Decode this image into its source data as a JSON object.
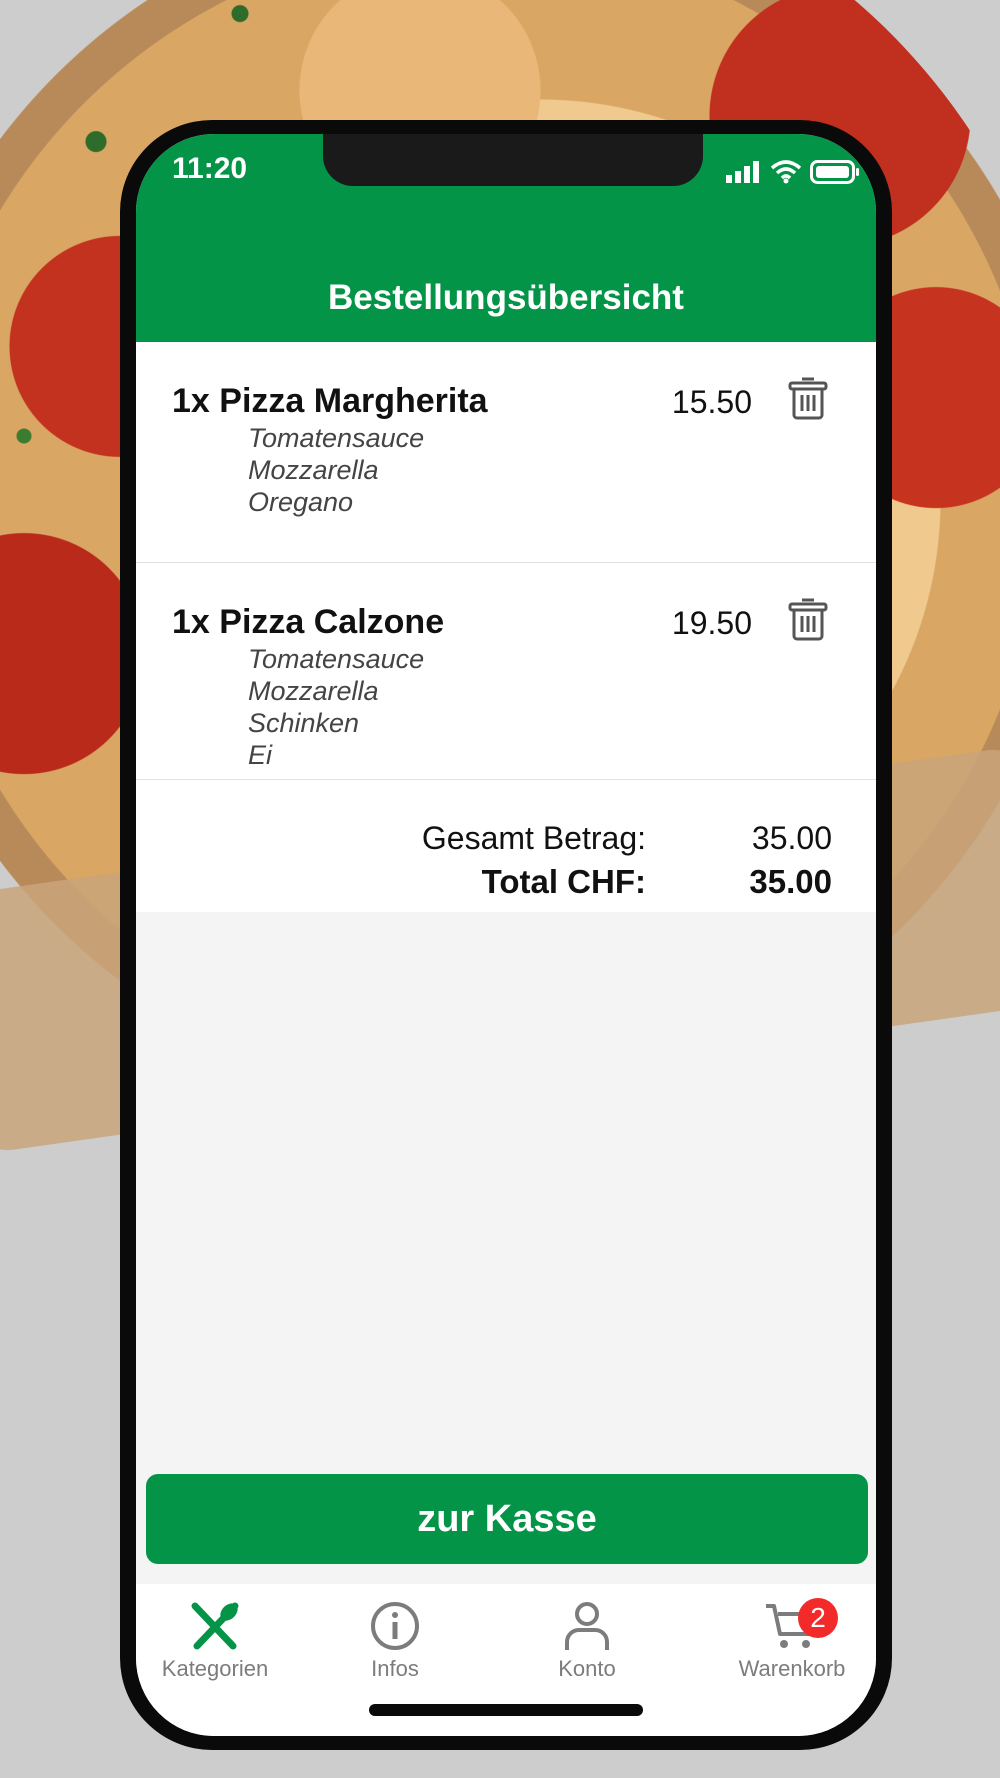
{
  "status_bar": {
    "time": "11:20"
  },
  "header": {
    "title": "Bestellungsübersicht"
  },
  "order_items": [
    {
      "name": "1x Pizza Margherita",
      "price": "15.50",
      "toppings": [
        "Tomatensauce",
        "Mozzarella",
        "Oregano"
      ]
    },
    {
      "name": "1x Pizza Calzone",
      "price": "19.50",
      "toppings": [
        "Tomatensauce",
        "Mozzarella",
        "Schinken",
        "Ei"
      ]
    }
  ],
  "totals": {
    "amount_label": "Gesamt Betrag:",
    "amount_value": "35.00",
    "total_label": "Total CHF:",
    "total_value": "35.00"
  },
  "checkout_button": {
    "label": "zur Kasse"
  },
  "tab_bar": {
    "tabs": [
      {
        "label": "Kategorien",
        "icon": "fork-knife-icon"
      },
      {
        "label": "Infos",
        "icon": "info-icon"
      },
      {
        "label": "Konto",
        "icon": "user-icon"
      },
      {
        "label": "Warenkorb",
        "icon": "cart-icon",
        "badge": "2"
      }
    ]
  },
  "colors": {
    "brand_green": "#039447",
    "badge_red": "#f22a2a",
    "tab_gray": "#7c7c7c"
  }
}
